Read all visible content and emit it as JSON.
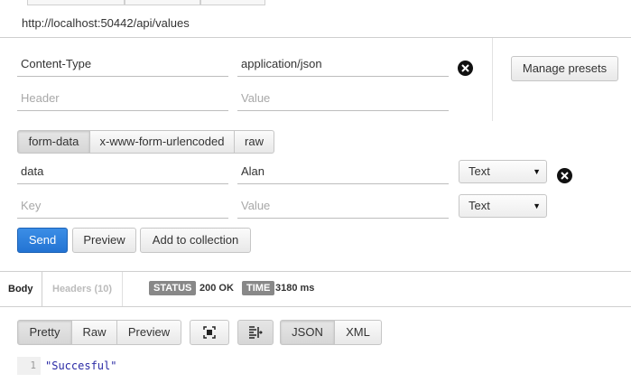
{
  "request": {
    "url": "http://localhost:50442/api/values"
  },
  "headers": {
    "rows": [
      {
        "key": "Content-Type",
        "value": "application/json"
      }
    ],
    "key_placeholder": "Header",
    "value_placeholder": "Value",
    "manage_presets_label": "Manage presets"
  },
  "body_modes": {
    "items": [
      "form-data",
      "x-www-form-urlencoded",
      "raw"
    ],
    "selected": "form-data"
  },
  "form_data": {
    "rows": [
      {
        "key": "data",
        "value": "Alan",
        "type": "Text"
      }
    ],
    "key_placeholder": "Key",
    "value_placeholder": "Value",
    "new_row_type": "Text"
  },
  "actions": {
    "send_label": "Send",
    "preview_label": "Preview",
    "add_to_collection_label": "Add to collection"
  },
  "response": {
    "tabs": [
      "Body",
      "Headers (10)"
    ],
    "status_label": "STATUS",
    "status_value": "200 OK",
    "time_label": "TIME",
    "time_value": "3180 ms",
    "view_modes": [
      "Pretty",
      "Raw",
      "Preview"
    ],
    "view_selected": "Pretty",
    "format_modes": [
      "JSON",
      "XML"
    ],
    "format_selected": "JSON",
    "lines": [
      {
        "number": "1",
        "text": "\"Succesful\""
      }
    ]
  },
  "colors": {
    "send_button": "#2c7fdd",
    "code_string": "#2a2aa5",
    "badge_bg": "#888888"
  }
}
